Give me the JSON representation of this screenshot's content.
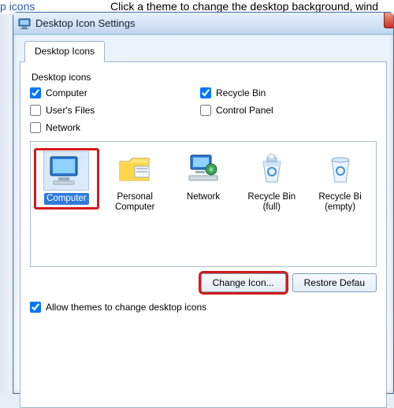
{
  "backdrop": {
    "link": "p icons",
    "hint": "Click a theme to change the desktop background, wind"
  },
  "window": {
    "title": "Desktop Icon Settings"
  },
  "tab": {
    "label": "Desktop Icons"
  },
  "group": {
    "title": "Desktop icons"
  },
  "checks": {
    "computer": {
      "label": "Computer",
      "checked": true
    },
    "recycle": {
      "label": "Recycle Bin",
      "checked": true
    },
    "userfiles": {
      "label": "User's Files",
      "checked": false
    },
    "controlpanel": {
      "label": "Control Panel",
      "checked": false
    },
    "network": {
      "label": "Network",
      "checked": false
    }
  },
  "icons": {
    "computer": {
      "label": "Computer"
    },
    "personal": {
      "label": "Personal Computer"
    },
    "network": {
      "label": "Network"
    },
    "recycle_full": {
      "label": "Recycle Bin (full)"
    },
    "recycle_empty": {
      "label": "Recycle Bi (empty)"
    }
  },
  "buttons": {
    "change": "Change Icon...",
    "restore": "Restore Defau"
  },
  "allow": {
    "label": "Allow themes to change desktop icons",
    "checked": true
  }
}
